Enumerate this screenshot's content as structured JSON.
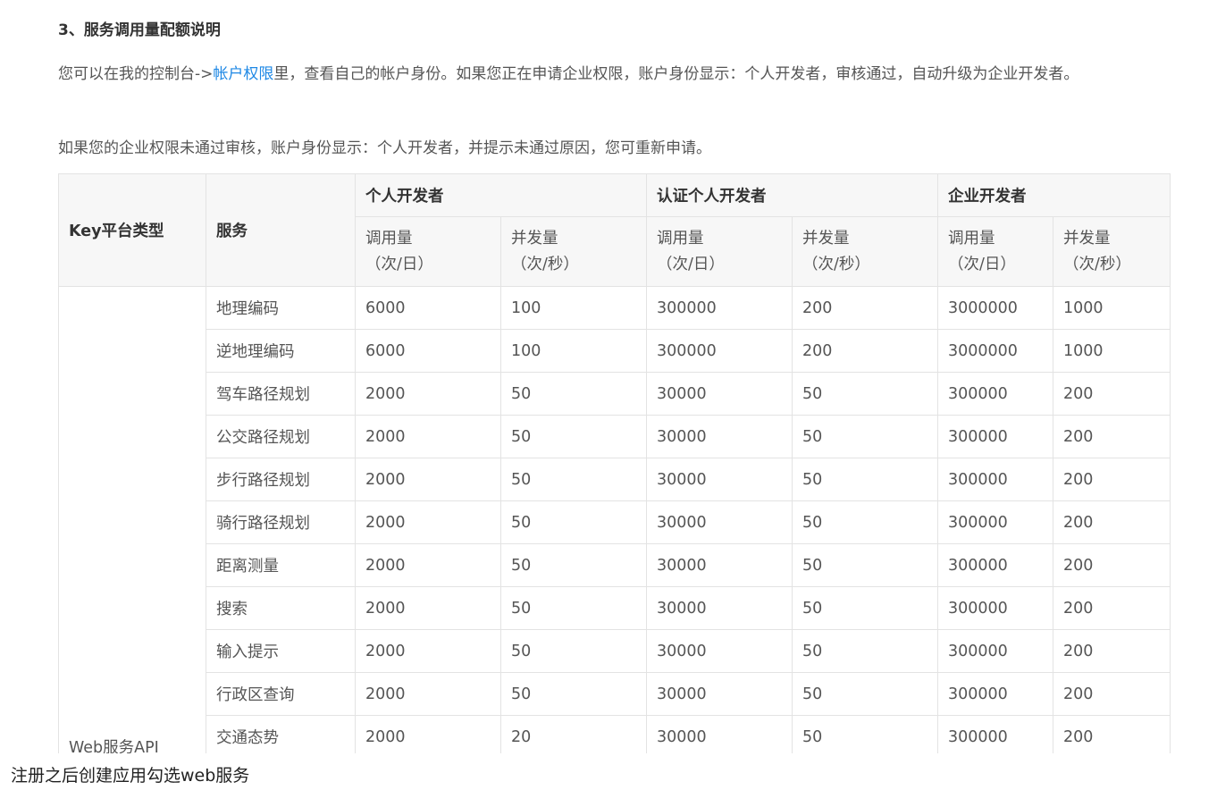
{
  "section_title": "3、服务调用量配额说明",
  "para1": {
    "prefix": "您可以在我的控制台->",
    "link": "帐户权限",
    "suffix": "里，查看自己的帐户身份。如果您正在申请企业权限，账户身份显示：个人开发者，审核通过，自动升级为企业开发者。"
  },
  "para2": "如果您的企业权限未通过审核，账户身份显示：个人开发者，并提示未通过原因，您可重新申请。",
  "table": {
    "col_platform": "Key平台类型",
    "col_service": "服务",
    "groups": [
      "个人开发者",
      "认证个人开发者",
      "企业开发者"
    ],
    "sub_headers": [
      {
        "line1": "调用量",
        "line2": "（次/日）"
      },
      {
        "line1": "并发量",
        "line2": "（次/秒）"
      },
      {
        "line1": "调用量",
        "line2": "（次/日）"
      },
      {
        "line1": "并发量",
        "line2": "（次/秒）"
      },
      {
        "line1": "调用量",
        "line2": "（次/日）"
      },
      {
        "line1": "并发量",
        "line2": "（次/秒）"
      }
    ],
    "platform": "Web服务API",
    "rows": [
      {
        "service": "地理编码",
        "values": [
          "6000",
          "100",
          "300000",
          "200",
          "3000000",
          "1000"
        ]
      },
      {
        "service": "逆地理编码",
        "values": [
          "6000",
          "100",
          "300000",
          "200",
          "3000000",
          "1000"
        ]
      },
      {
        "service": "驾车路径规划",
        "values": [
          "2000",
          "50",
          "30000",
          "50",
          "300000",
          "200"
        ]
      },
      {
        "service": "公交路径规划",
        "values": [
          "2000",
          "50",
          "30000",
          "50",
          "300000",
          "200"
        ]
      },
      {
        "service": "步行路径规划",
        "values": [
          "2000",
          "50",
          "30000",
          "50",
          "300000",
          "200"
        ]
      },
      {
        "service": "骑行路径规划",
        "values": [
          "2000",
          "50",
          "30000",
          "50",
          "300000",
          "200"
        ]
      },
      {
        "service": "距离测量",
        "values": [
          "2000",
          "50",
          "30000",
          "50",
          "300000",
          "200"
        ]
      },
      {
        "service": "搜索",
        "values": [
          "2000",
          "50",
          "30000",
          "50",
          "300000",
          "200"
        ]
      },
      {
        "service": "输入提示",
        "values": [
          "2000",
          "50",
          "30000",
          "50",
          "300000",
          "200"
        ]
      },
      {
        "service": "行政区查询",
        "values": [
          "2000",
          "50",
          "30000",
          "50",
          "300000",
          "200"
        ]
      },
      {
        "service": "交通态势",
        "values": [
          "2000",
          "20",
          "30000",
          "50",
          "300000",
          "200"
        ]
      }
    ]
  },
  "footer_text": "注册之后创建应用勾选web服务"
}
